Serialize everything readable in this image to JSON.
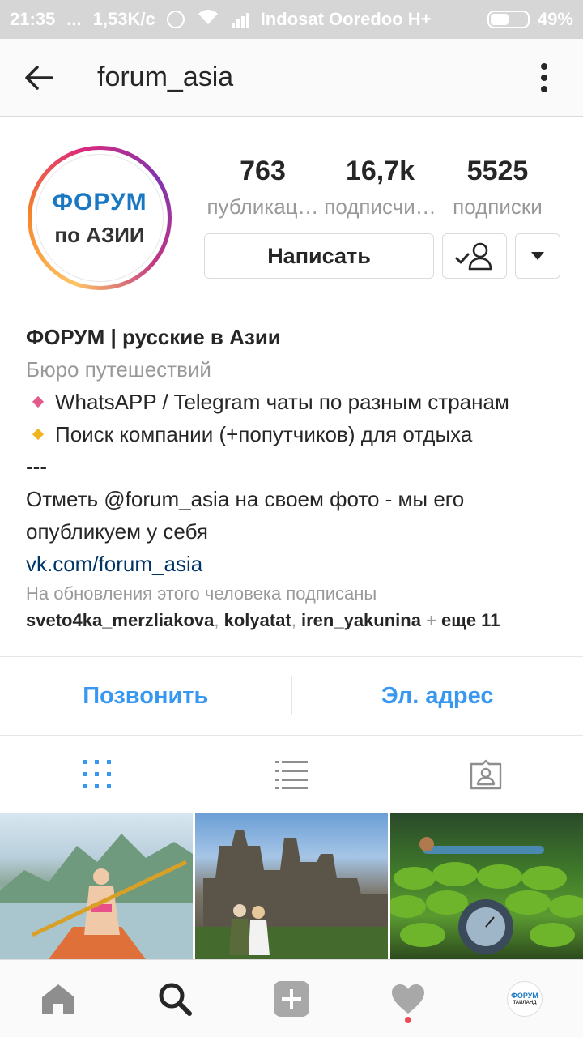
{
  "status_bar": {
    "time": "21:35",
    "dots": "...",
    "speed": "1,53K/c",
    "carrier": "Indosat Ooredoo H+",
    "battery": "49%"
  },
  "header": {
    "username": "forum_asia"
  },
  "profile": {
    "avatar_line1": "ФОРУМ",
    "avatar_line2": "по АЗИИ",
    "stats": [
      {
        "value": "763",
        "label": "публикац…"
      },
      {
        "value": "16,7k",
        "label": "подписчи…"
      },
      {
        "value": "5525",
        "label": "подписки"
      }
    ],
    "message_button": "Написать"
  },
  "bio": {
    "name": "ФОРУМ | русские в Азии",
    "category": "Бюро путешествий",
    "bullets": [
      {
        "text": "WhatsAPP / Telegram чаты по разным странам",
        "color": "#e05a8c"
      },
      {
        "text": "Поиск компании (+попутчиков) для отдыха",
        "color": "#f0b41e"
      }
    ],
    "separator": "---",
    "line1": "Отметь @forum_asia на своем фото - мы его",
    "line2": "опубликуем у себя",
    "link": "vk.com/forum_asia"
  },
  "followed_by": {
    "title": "На обновления этого человека подписаны",
    "users": [
      "sveto4ka_merzliakova",
      "kolyatat",
      "iren_yakunina"
    ],
    "more": "еще 11"
  },
  "contact": {
    "call": "Позвонить",
    "email": "Эл. адрес"
  },
  "bottom_nav": {
    "avatar_line1": "ФОРУМ",
    "avatar_line2": "ТАИЛАНД"
  },
  "colors": {
    "accent": "#3897f0",
    "link": "#003569",
    "muted": "#999999",
    "active_tab": "#3897f0"
  }
}
